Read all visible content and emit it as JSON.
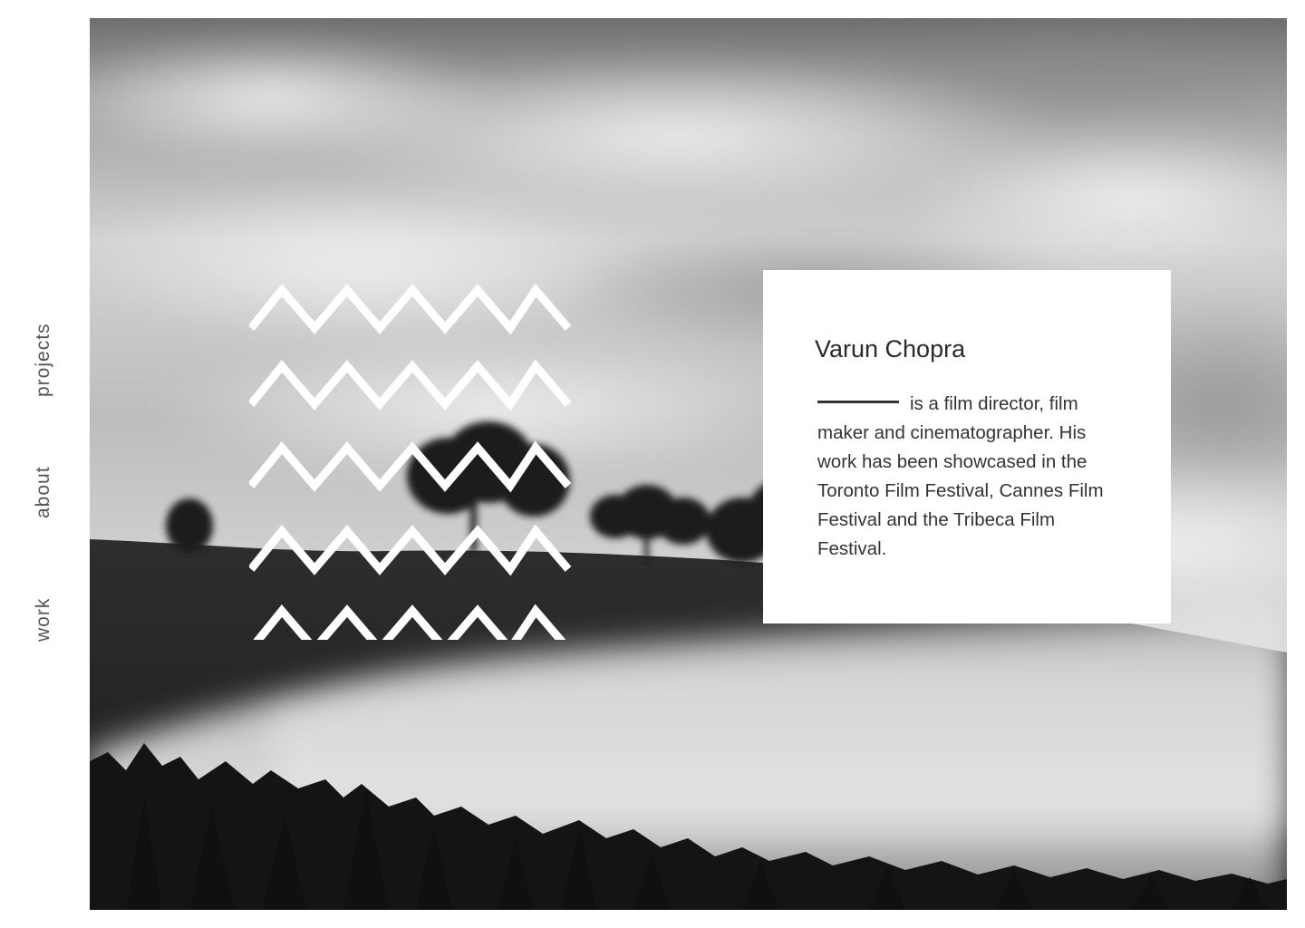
{
  "nav": {
    "items": [
      {
        "label": "projects"
      },
      {
        "label": "about"
      },
      {
        "label": "work"
      }
    ]
  },
  "hero": {
    "image": "black-and-white misty landscape with trees and clouds",
    "decoration": "zigzag-pattern",
    "zigzag_rows": 5
  },
  "card": {
    "name": "Varun Chopra",
    "bio": "is a film director, film maker and cinematographer. His work has been showcased in the Toronto Film Festival, Cannes Film Festival and the Tribeca Film Festival."
  },
  "colors": {
    "background": "#ffffff",
    "text": "#333333",
    "nav_text": "#555555",
    "card_bg": "#ffffff",
    "zigzag": "#ffffff"
  }
}
